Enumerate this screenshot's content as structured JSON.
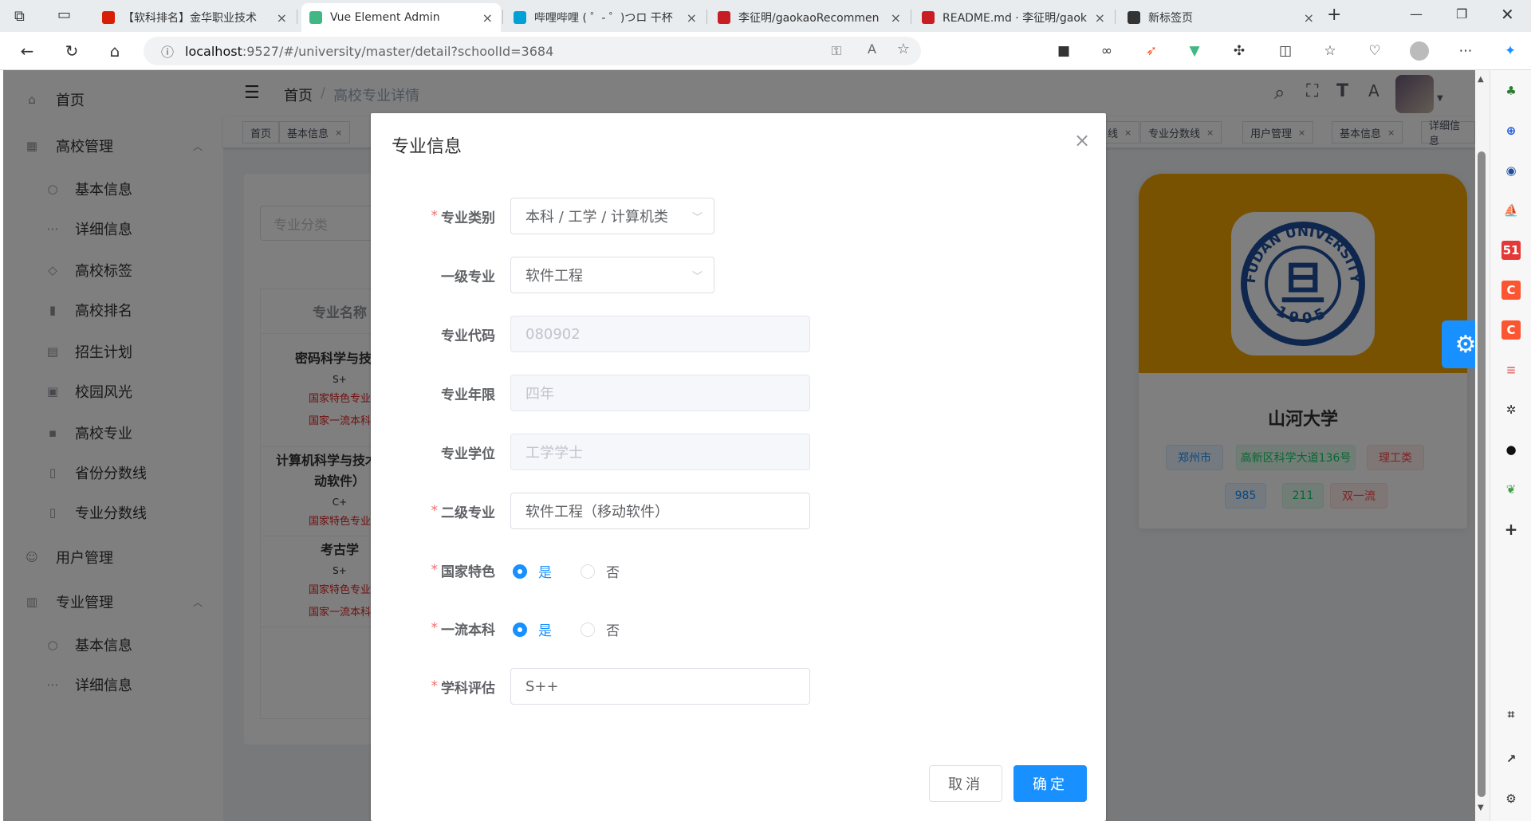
{
  "browser": {
    "tabs": [
      {
        "title": "【软科排名】金华职业技术",
        "icon_color": "#d81e06",
        "icon": "rank-icon"
      },
      {
        "title": "Vue Element Admin",
        "icon_color": "#41b883",
        "icon": "vue-icon"
      },
      {
        "title": "哔哩哔哩 ( ゜- ゜)つロ 干杯",
        "icon_color": "#00a1d6",
        "icon": "bilibili-icon"
      },
      {
        "title": "李征明/gaokaoRecommen",
        "icon_color": "#c71d23",
        "icon": "gitee-icon"
      },
      {
        "title": "README.md · 李征明/gaok",
        "icon_color": "#c71d23",
        "icon": "gitee-icon"
      },
      {
        "title": "新标签页",
        "icon_color": "#333333",
        "icon": "infinity-icon"
      }
    ],
    "url_host": "localhost",
    "url_path": ":9527/#/university/master/detail?schoolId=3684",
    "new_tab_symbol": "+"
  },
  "sidebar": {
    "top_items": [
      {
        "label": "首页",
        "icon": "home-icon"
      },
      {
        "label": "高校管理",
        "icon": "school-icon"
      },
      {
        "label": "用户管理",
        "icon": "user-icon"
      },
      {
        "label": "专业管理",
        "icon": "book-icon"
      }
    ],
    "university_sub": [
      {
        "label": "基本信息",
        "icon": "chat-icon"
      },
      {
        "label": "详细信息",
        "icon": "more-icon"
      },
      {
        "label": "高校标签",
        "icon": "tag-icon"
      },
      {
        "label": "高校排名",
        "icon": "chart-icon"
      },
      {
        "label": "招生计划",
        "icon": "doc-icon"
      },
      {
        "label": "校园风光",
        "icon": "picture-icon"
      },
      {
        "label": "高校专业",
        "icon": "list-icon"
      },
      {
        "label": "省份分数线",
        "icon": "bar-icon"
      },
      {
        "label": "专业分数线",
        "icon": "bar-icon"
      }
    ],
    "major_sub": [
      {
        "label": "基本信息",
        "icon": "chat-icon"
      },
      {
        "label": "详细信息",
        "icon": "more-icon"
      }
    ]
  },
  "navbar": {
    "breadcrumb_home": "首页",
    "breadcrumb_sep": "/",
    "breadcrumb_current": "高校专业详情"
  },
  "tags_view": {
    "left": [
      "首页",
      "基本信息"
    ],
    "right": [
      "专业分数线",
      "用户管理",
      "基本信息",
      "详细信息"
    ],
    "partial_right": "线"
  },
  "content": {
    "filter_placeholder": "专业分类",
    "table_header": "专业名称",
    "rows": [
      {
        "name": "密码科学与技术",
        "grade": "S+",
        "tags": [
          "国家特色专业",
          "国家一流本科"
        ]
      },
      {
        "name": "计算机科学与技术（移动软件）",
        "grade": "C+",
        "tags": [
          "国家特色专业"
        ]
      },
      {
        "name": "考古学",
        "grade": "S+",
        "tags": [
          "国家特色专业",
          "国家一流本科"
        ]
      }
    ]
  },
  "university": {
    "name": "山河大学",
    "logo_text_top": "FUDAN UNIVERSITY",
    "logo_year": "1905",
    "logo_char": "旦",
    "tags_row1": [
      {
        "text": "郑州市",
        "color": "#1890ff",
        "bg": "#e8f4ff",
        "border": "#d1e9ff"
      },
      {
        "text": "高新区科学大道136号",
        "color": "#13ce66",
        "bg": "#e7faf0",
        "border": "#d0f5e0"
      },
      {
        "text": "理工类",
        "color": "#ff4949",
        "bg": "#ffeded",
        "border": "#ffdbdb"
      }
    ],
    "tags_row2": [
      {
        "text": "985",
        "color": "#1890ff",
        "bg": "#e8f4ff",
        "border": "#d1e9ff"
      },
      {
        "text": "211",
        "color": "#13ce66",
        "bg": "#e7faf0",
        "border": "#d0f5e0"
      },
      {
        "text": "双一流",
        "color": "#ff4949",
        "bg": "#ffeded",
        "border": "#ffdbdb"
      }
    ],
    "header_color": "#f0a500"
  },
  "dialog": {
    "title": "专业信息",
    "close_symbol": "×",
    "fields": {
      "category": {
        "label": "专业类别",
        "value": "本科 / 工学 / 计算机类",
        "required": true
      },
      "first_level": {
        "label": "一级专业",
        "value": "软件工程",
        "required": false
      },
      "code": {
        "label": "专业代码",
        "placeholder": "080902",
        "required": false
      },
      "years": {
        "label": "专业年限",
        "placeholder": "四年",
        "required": false
      },
      "degree": {
        "label": "专业学位",
        "placeholder": "工学学士",
        "required": false
      },
      "second_level": {
        "label": "二级专业",
        "value": "软件工程（移动软件）",
        "required": true
      },
      "national_feature": {
        "label": "国家特色",
        "options": [
          "是",
          "否"
        ],
        "selected": "是",
        "required": true
      },
      "first_class": {
        "label": "一流本科",
        "options": [
          "是",
          "否"
        ],
        "selected": "是",
        "required": true
      },
      "evaluation": {
        "label": "学科评估",
        "value": "S++",
        "required": true
      }
    },
    "required_mark": "*",
    "cancel_label": "取消",
    "confirm_label": "确定"
  },
  "colors": {
    "primary": "#1890ff",
    "danger": "#f56c6c",
    "overlay": "rgba(0,0,0,0.5)"
  }
}
